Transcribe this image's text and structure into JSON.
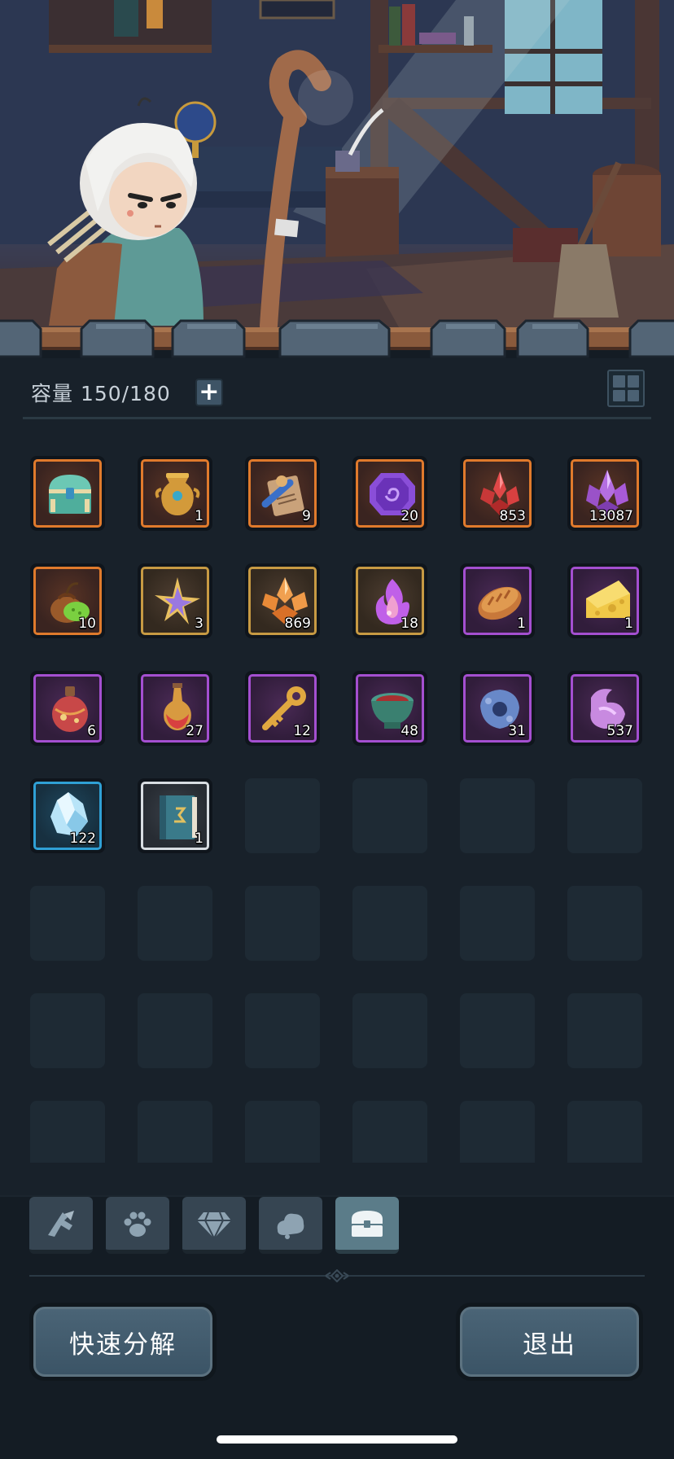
{
  "inventory": {
    "capacity_label": "容量 150/180",
    "add_label": "+"
  },
  "items": [
    {
      "name": "treasure-chest",
      "rarity": "orange",
      "qty": ""
    },
    {
      "name": "golden-urn",
      "rarity": "orange",
      "qty": "1"
    },
    {
      "name": "scroll-map",
      "rarity": "orange",
      "qty": "9"
    },
    {
      "name": "purple-rune-stone",
      "rarity": "orange",
      "qty": "20"
    },
    {
      "name": "red-crystal",
      "rarity": "orange",
      "qty": "853"
    },
    {
      "name": "purple-crystal",
      "rarity": "orange",
      "qty": "13087"
    },
    {
      "name": "seed-pouch",
      "rarity": "orange",
      "qty": "10"
    },
    {
      "name": "star-shard",
      "rarity": "gold",
      "qty": "3"
    },
    {
      "name": "orange-crystal",
      "rarity": "gold",
      "qty": "869"
    },
    {
      "name": "spirit-flame",
      "rarity": "gold",
      "qty": "18"
    },
    {
      "name": "bread-loaf",
      "rarity": "purple",
      "qty": "1"
    },
    {
      "name": "cheese-wedge",
      "rarity": "purple",
      "qty": "1"
    },
    {
      "name": "red-potion",
      "rarity": "purple",
      "qty": "6"
    },
    {
      "name": "elixir-bottle",
      "rarity": "purple",
      "qty": "27"
    },
    {
      "name": "golden-key",
      "rarity": "purple",
      "qty": "12"
    },
    {
      "name": "stone-bowl",
      "rarity": "purple",
      "qty": "48"
    },
    {
      "name": "blue-ore",
      "rarity": "purple",
      "qty": "31"
    },
    {
      "name": "pink-ore",
      "rarity": "purple",
      "qty": "537"
    },
    {
      "name": "ice-crystal",
      "rarity": "blue",
      "qty": "122"
    },
    {
      "name": "skill-book",
      "rarity": "white",
      "qty": "1"
    }
  ],
  "tabs": [
    {
      "name": "equipment-tab",
      "icon": "equipment-icon",
      "active": false
    },
    {
      "name": "pet-tab",
      "icon": "paw-icon",
      "active": false
    },
    {
      "name": "gem-tab",
      "icon": "diamond-icon",
      "active": false
    },
    {
      "name": "material-tab",
      "icon": "ore-icon",
      "active": false
    },
    {
      "name": "chest-tab",
      "icon": "chest-icon",
      "active": true
    }
  ],
  "buttons": {
    "decompose_label": "快速分解",
    "exit_label": "退出"
  },
  "colors": {
    "orange_rarity": "#e07a2c",
    "gold_rarity": "#c79a43",
    "purple_rarity": "#a44fd0",
    "blue_rarity": "#2fa0d5",
    "white_rarity": "#d8dde2",
    "panel_bg": "#18212a"
  }
}
